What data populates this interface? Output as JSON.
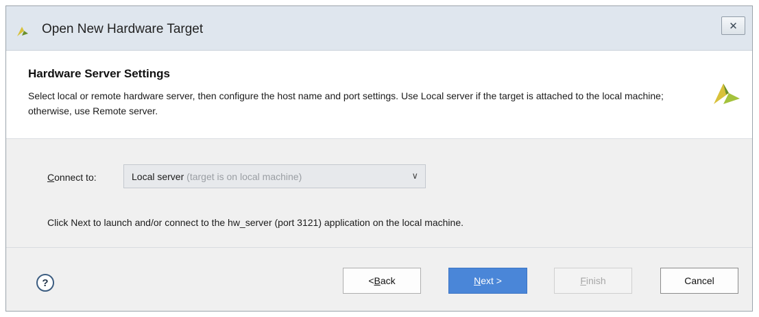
{
  "window": {
    "title": "Open New Hardware Target",
    "close_symbol": "✕",
    "logo_icon": "xilinx-logo-icon"
  },
  "header": {
    "title": "Hardware Server Settings",
    "description": "Select local or remote hardware server, then configure the host name and port settings. Use Local server if the target is attached to the local machine; otherwise, use Remote server."
  },
  "connect": {
    "label_mnemonic": "C",
    "label_rest": "onnect to:",
    "selected_value": "Local server",
    "selected_hint": "(target is on local machine)",
    "chevron": "∨"
  },
  "info_text": "Click Next to launch and/or connect to the hw_server (port 3121) application on the local machine.",
  "footer": {
    "help_symbol": "?",
    "back": {
      "prefix": "< ",
      "mnemonic": "B",
      "rest": "ack"
    },
    "next": {
      "mnemonic": "N",
      "rest": "ext >"
    },
    "finish": {
      "mnemonic": "F",
      "rest": "inish"
    },
    "cancel": "Cancel"
  },
  "colors": {
    "titlebar": "#dfe6ee",
    "accent_button": "#4a86d8",
    "logo_yellow": "#d8c13a",
    "logo_green": "#6a8f2b"
  }
}
